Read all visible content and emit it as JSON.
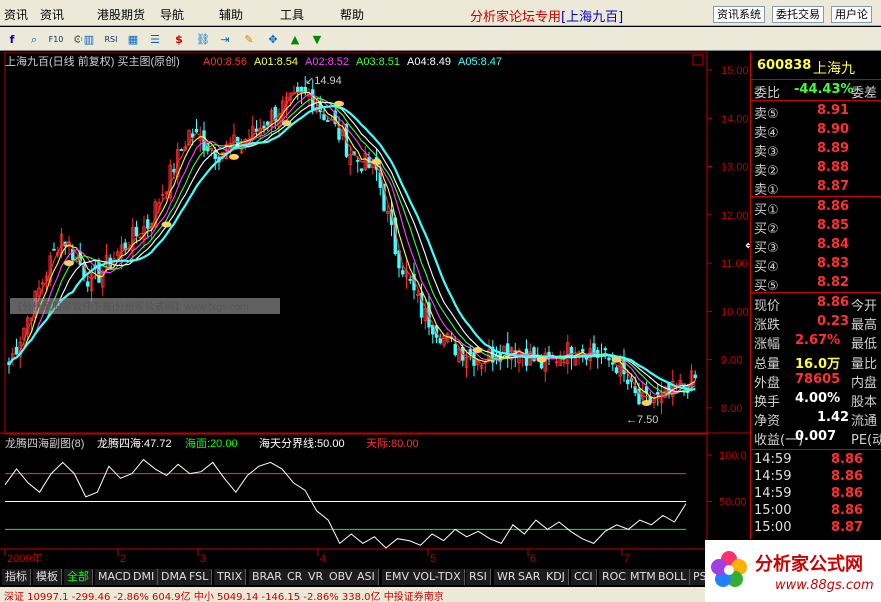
{
  "menu": [
    "资讯",
    "港股期货",
    "导航",
    "辅助",
    "工具",
    "帮助"
  ],
  "forum_title": "分析家论坛专用",
  "forum_stock": "[上海九百]",
  "right_buttons": [
    "资讯系统",
    "委托交易",
    "用户论"
  ],
  "toolbar_icons": [
    "f-icon",
    "zoom-icon",
    "f10-icon",
    "gear-icon",
    "chart-icon",
    "rsi-icon",
    "grid-icon",
    "dollar-icon",
    "link-icon",
    "export-icon",
    "pen-icon",
    "move-icon",
    "up-arrow-icon",
    "down-arrow-icon"
  ],
  "main_chart": {
    "title": "上海九百(日线 前复权) 买主图(原创)",
    "ma_labels": [
      {
        "name": "A00",
        "value": "8.56",
        "color": "#ff3030"
      },
      {
        "name": "A01",
        "value": "8.54",
        "color": "#ffff40"
      },
      {
        "name": "A02",
        "value": "8.52",
        "color": "#ff40ff"
      },
      {
        "name": "A03",
        "value": "8.51",
        "color": "#40ff40"
      },
      {
        "name": "A04",
        "value": "8.49",
        "color": "#ffffff"
      },
      {
        "name": "A05",
        "value": "8.47",
        "color": "#40ffff"
      }
    ],
    "high_label": "14.94",
    "low_label": "7.50",
    "watermark": "【分析家股票软件下载|分析家公式网】www.fxgs.com",
    "y_ticks": [
      "15.00",
      "14.00",
      "13.00",
      "12.00",
      "11.00",
      "10.00",
      "9.00",
      "8.00"
    ]
  },
  "sub_chart": {
    "title": "龙腾四海副图(8)",
    "value_label": "龙腾四海:47.72",
    "line_labels": [
      {
        "name": "海面",
        "value": "20.00",
        "color": "#00ff00"
      },
      {
        "name": "海天分界线",
        "value": "50.00",
        "color": "#ffffff"
      },
      {
        "name": "天际",
        "value": "80.00",
        "color": "#ff3030"
      }
    ],
    "y_ticks": [
      "100.0",
      "50.00",
      "0.00"
    ]
  },
  "x_ticks": [
    "2009年",
    "2",
    "3",
    "4",
    "5",
    "6",
    "7"
  ],
  "quote": {
    "code": "600838",
    "name": "上海九",
    "ratio_label": "委比",
    "ratio_value": "-44.43%",
    "ratio_suffix": "委差",
    "asks": [
      {
        "label": "卖⑤",
        "price": "8.91"
      },
      {
        "label": "卖④",
        "price": "8.90"
      },
      {
        "label": "卖③",
        "price": "8.89"
      },
      {
        "label": "卖②",
        "price": "8.88"
      },
      {
        "label": "卖①",
        "price": "8.87"
      }
    ],
    "bids": [
      {
        "label": "买①",
        "price": "8.86"
      },
      {
        "label": "买②",
        "price": "8.85"
      },
      {
        "label": "买③",
        "price": "8.84"
      },
      {
        "label": "买④",
        "price": "8.83"
      },
      {
        "label": "买⑤",
        "price": "8.82"
      }
    ],
    "stats": [
      {
        "label": "现价",
        "value": "8.86",
        "suffix": "今开",
        "color": "#ff3030"
      },
      {
        "label": "涨跌",
        "value": "0.23",
        "suffix": "最高",
        "color": "#ff3030"
      },
      {
        "label": "涨幅",
        "value": "2.67%",
        "suffix": "最低",
        "color": "#ff3030"
      },
      {
        "label": "总量",
        "value": "16.0万",
        "suffix": "量比",
        "color": "#ffff40"
      },
      {
        "label": "外盘",
        "value": "78605",
        "suffix": "内盘",
        "color": "#ff3030"
      },
      {
        "label": "换手",
        "value": "4.00%",
        "suffix": "股本",
        "color": "#ffffff"
      },
      {
        "label": "净资",
        "value": "1.42",
        "suffix": "流通",
        "color": "#ffffff"
      },
      {
        "label": "收益(一)",
        "value": "0.007",
        "suffix": "PE(动",
        "color": "#ffffff"
      }
    ],
    "ticks": [
      {
        "time": "14:59",
        "price": "8.86"
      },
      {
        "time": "14:59",
        "price": "8.86"
      },
      {
        "time": "14:59",
        "price": "8.86"
      },
      {
        "time": "15:00",
        "price": "8.86"
      },
      {
        "time": "15:00",
        "price": "8.87"
      }
    ]
  },
  "tabs": [
    "指标",
    "模板",
    "全部",
    "MACD",
    "DMI",
    "DMA",
    "FSL",
    "TRIX",
    "BRAR",
    "CR",
    "VR",
    "OBV",
    "ASI",
    "EMV",
    "VOL-TDX",
    "RSI",
    "WR",
    "SAR",
    "KDJ",
    "CCI",
    "ROC",
    "MTM",
    "BOLL",
    "PSY",
    "M"
  ],
  "status_text": "深证 10997.1  -299.46 -2.86%  604.9亿   中小 5049.14 -146.15 -2.86%  338.0亿          中投证券南京",
  "logo": {
    "text": "分析家公式网",
    "url": "www.88gs.com"
  },
  "colors": {
    "up": "#ff3030",
    "down": "#40ffff",
    "axis": "#c00000",
    "ma": [
      "#ff3030",
      "#ffff40",
      "#ff40ff",
      "#40ff40",
      "#ffffff",
      "#40ffff"
    ]
  },
  "chart_data": {
    "type": "candlestick",
    "main": {
      "ylim": [
        7.5,
        15.0
      ],
      "x_labels": [
        "2009年",
        "2",
        "3",
        "4",
        "5",
        "6",
        "7"
      ],
      "anchors": [
        [
          0,
          8.9
        ],
        [
          14,
          11.6
        ],
        [
          22,
          10.6
        ],
        [
          30,
          11.3
        ],
        [
          37,
          11.8
        ],
        [
          48,
          13.7
        ],
        [
          56,
          13.3
        ],
        [
          64,
          13.6
        ],
        [
          72,
          14.2
        ],
        [
          80,
          14.5
        ],
        [
          86,
          13.9
        ],
        [
          92,
          13.2
        ],
        [
          98,
          12.9
        ],
        [
          103,
          11.3
        ],
        [
          110,
          10.0
        ],
        [
          118,
          9.3
        ],
        [
          126,
          9.0
        ],
        [
          134,
          9.3
        ],
        [
          142,
          8.9
        ],
        [
          152,
          9.3
        ],
        [
          162,
          8.9
        ],
        [
          168,
          8.1
        ],
        [
          174,
          8.2
        ],
        [
          183,
          8.6
        ]
      ],
      "high": 14.94,
      "low": 7.5
    },
    "sub": {
      "ylim": [
        0,
        100
      ],
      "levels": [
        20,
        50,
        80
      ],
      "series": [
        68,
        85,
        70,
        60,
        80,
        92,
        80,
        55,
        60,
        88,
        75,
        80,
        95,
        85,
        78,
        90,
        80,
        82,
        92,
        75,
        60,
        78,
        88,
        92,
        85,
        70,
        62,
        40,
        30,
        5,
        15,
        5,
        12,
        0,
        10,
        8,
        3,
        15,
        8,
        20,
        12,
        18,
        10,
        5,
        25,
        15,
        30,
        20,
        28,
        18,
        10,
        5,
        18,
        25,
        20,
        30,
        25,
        35,
        28,
        47.72
      ]
    }
  }
}
